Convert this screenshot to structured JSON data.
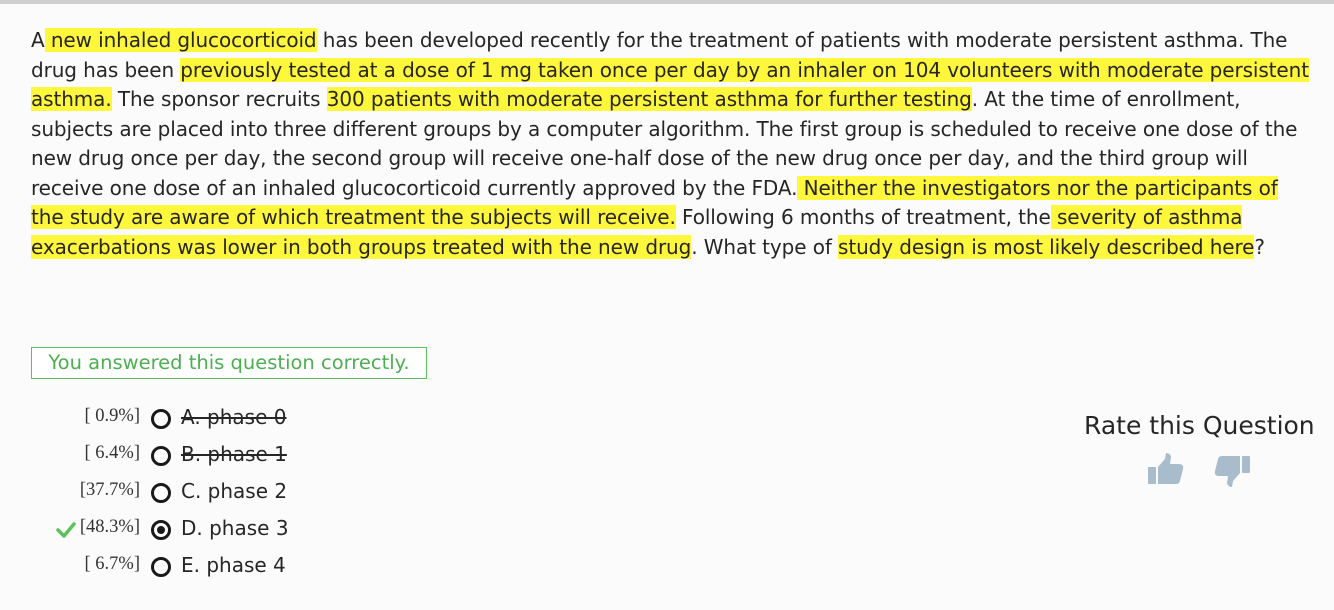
{
  "question": {
    "segments": [
      {
        "text": "A",
        "highlight": false
      },
      {
        "text": " new inhaled glucocorticoid",
        "highlight": true
      },
      {
        "text": " has been developed recently for the treatment of patients with moderate persistent asthma. The drug has been ",
        "highlight": false
      },
      {
        "text": "previously tested at a dose of 1 mg taken once per day by an inhaler on 104 volunteers with moderate persistent asthma.",
        "highlight": true
      },
      {
        "text": " The sponsor recruits ",
        "highlight": false
      },
      {
        "text": "300 patients with moderate persistent asthma for further testing",
        "highlight": true
      },
      {
        "text": ". At the time of enrollment, subjects are placed into three different groups by a computer algorithm. The first group is scheduled to receive one dose of the new drug once per day, the second group will receive one-half dose of the new drug once per day, and the third group will receive one dose of an inhaled glucocorticoid currently approved by the FDA.",
        "highlight": false
      },
      {
        "text": " Neither the investigators nor the participants of the study are aware of which treatment the subjects will receive.",
        "highlight": true
      },
      {
        "text": " Following 6 months of treatment, the",
        "highlight": false
      },
      {
        "text": " severity of asthma exacerbations was lower in both groups treated with the new drug",
        "highlight": true
      },
      {
        "text": ". What type of ",
        "highlight": false
      },
      {
        "text": "study design is most likely described here",
        "highlight": true
      },
      {
        "text": "?",
        "highlight": false
      }
    ]
  },
  "result_message": "You answered this question correctly.",
  "answers": [
    {
      "percent": "[ 0.9%]",
      "label": "A. phase 0",
      "struck": true,
      "selected": false,
      "correct": false
    },
    {
      "percent": "[ 6.4%]",
      "label": "B. phase 1",
      "struck": true,
      "selected": false,
      "correct": false
    },
    {
      "percent": "[37.7%]",
      "label": "C. phase 2",
      "struck": false,
      "selected": false,
      "correct": false
    },
    {
      "percent": "[48.3%]",
      "label": "D. phase 3",
      "struck": false,
      "selected": true,
      "correct": true
    },
    {
      "percent": "[ 6.7%]",
      "label": "E. phase 4",
      "struck": false,
      "selected": false,
      "correct": false
    }
  ],
  "rating": {
    "title": "Rate this Question",
    "thumb_up_icon": "thumbs-up-icon",
    "thumb_down_icon": "thumbs-down-icon",
    "icon_color": "#a9bccb"
  },
  "colors": {
    "highlight": "#fff73c",
    "correct_green": "#4caf50",
    "check_green": "#5cc25c"
  }
}
